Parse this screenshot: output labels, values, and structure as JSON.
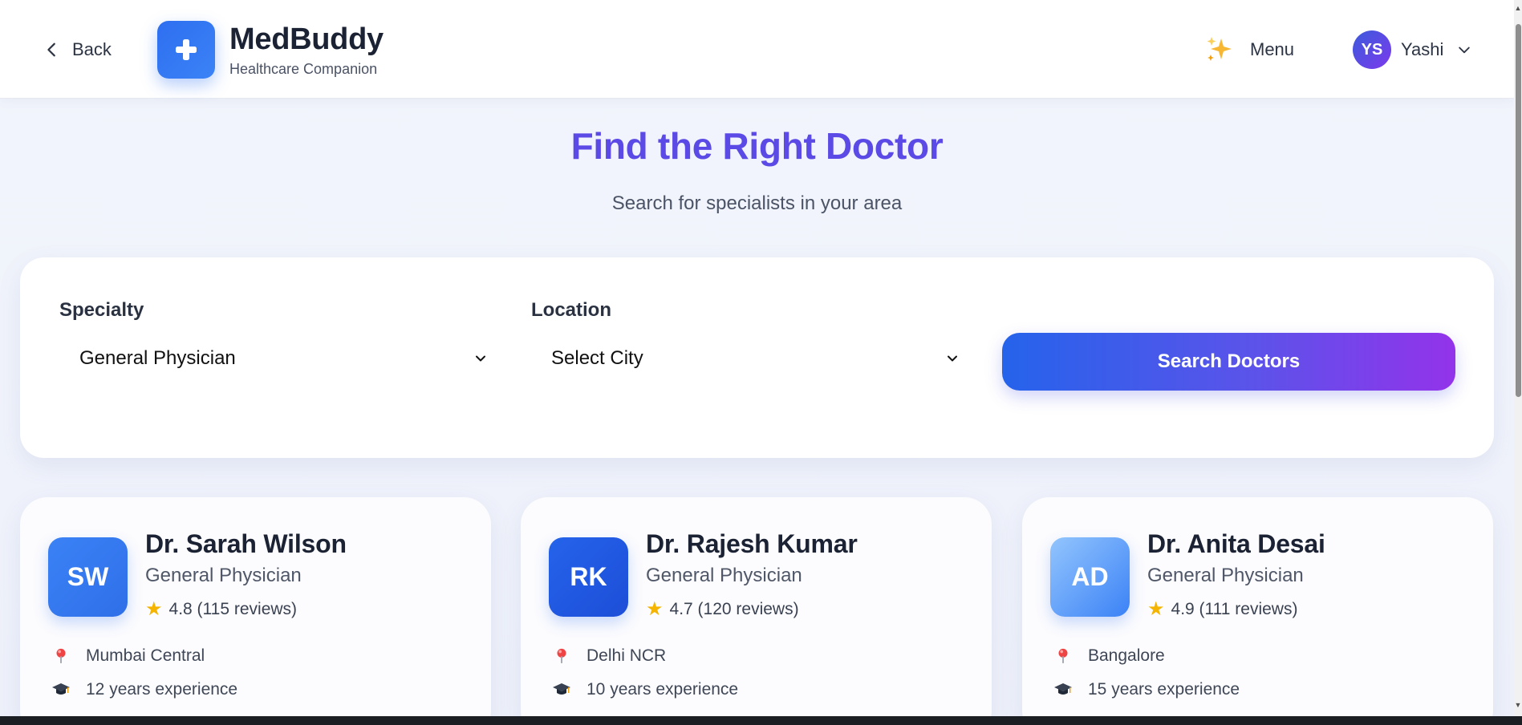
{
  "header": {
    "back_label": "Back",
    "brand_name": "MedBuddy",
    "brand_tagline": "Healthcare Companion",
    "menu_label": "Menu",
    "user_initials": "YS",
    "user_name": "Yashi"
  },
  "hero": {
    "title": "Find the Right Doctor",
    "subtitle": "Search for specialists in your area"
  },
  "search": {
    "specialty_label": "Specialty",
    "specialty_value": "General Physician",
    "location_label": "Location",
    "location_value": "Select City",
    "button_label": "Search Doctors"
  },
  "doctors": [
    {
      "initials": "SW",
      "name": "Dr. Sarah Wilson",
      "specialty": "General Physician",
      "rating": "4.8 (115 reviews)",
      "location": "Mumbai Central",
      "experience": "12 years experience",
      "avatar_color_start": "#3b82f6",
      "avatar_color_end": "#2f6fe8"
    },
    {
      "initials": "RK",
      "name": "Dr. Rajesh Kumar",
      "specialty": "General Physician",
      "rating": "4.7 (120 reviews)",
      "location": "Delhi NCR",
      "experience": "10 years experience",
      "avatar_color_start": "#2563eb",
      "avatar_color_end": "#1d4ed8"
    },
    {
      "initials": "AD",
      "name": "Dr. Anita Desai",
      "specialty": "General Physician",
      "rating": "4.9 (111 reviews)",
      "location": "Bangalore",
      "experience": "15 years experience",
      "avatar_color_start": "#93c5fd",
      "avatar_color_end": "#3b82f6"
    }
  ],
  "icons": {
    "back": "chevron-left-icon",
    "logo": "medical-cross-icon",
    "menu": "sparkles-icon",
    "user_menu": "chevron-down-icon",
    "select": "chevron-down-icon",
    "location": "map-pin-icon",
    "experience": "graduation-cap-icon",
    "rating": "star-icon"
  },
  "colors": {
    "accent": "#5b4ae6",
    "primary_blue": "#2563eb",
    "gradient_end": "#9333ea",
    "star": "#f5b400"
  }
}
